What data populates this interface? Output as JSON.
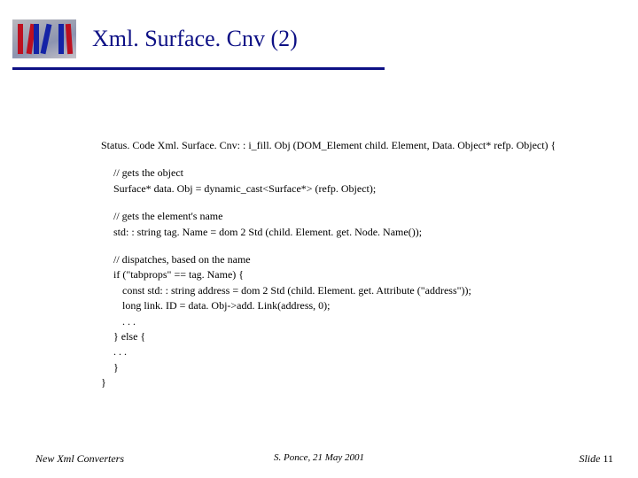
{
  "header": {
    "title": "Xml. Surface. Cnv (2)"
  },
  "code": {
    "sig": "Status. Code Xml. Surface. Cnv: : i_fill. Obj (DOM_Element child. Element, Data. Object* refp. Object) {",
    "c1a": " // gets the object",
    "c1b": "Surface* data. Obj = dynamic_cast<Surface*> (refp. Object);",
    "c2a": "// gets the element's name",
    "c2b": "std: : string tag. Name = dom 2 Std (child. Element. get. Node. Name());",
    "c3a": "// dispatches, based on the name",
    "c3b": "if (\"tabprops\" == tag. Name) {",
    "c3c": "const std: : string address = dom 2 Std (child. Element. get. Attribute (\"address\"));",
    "c3d": "long link. ID = data. Obj->add. Link(address, 0);",
    "c3e": ". . .",
    "c3f": "} else {",
    "c3g": ". . .",
    "c3h": "}",
    "c3i": "}"
  },
  "footer": {
    "left": "New Xml Converters",
    "center": "S. Ponce, 21 May 2001",
    "right_label": "Slide ",
    "right_num": "11"
  }
}
